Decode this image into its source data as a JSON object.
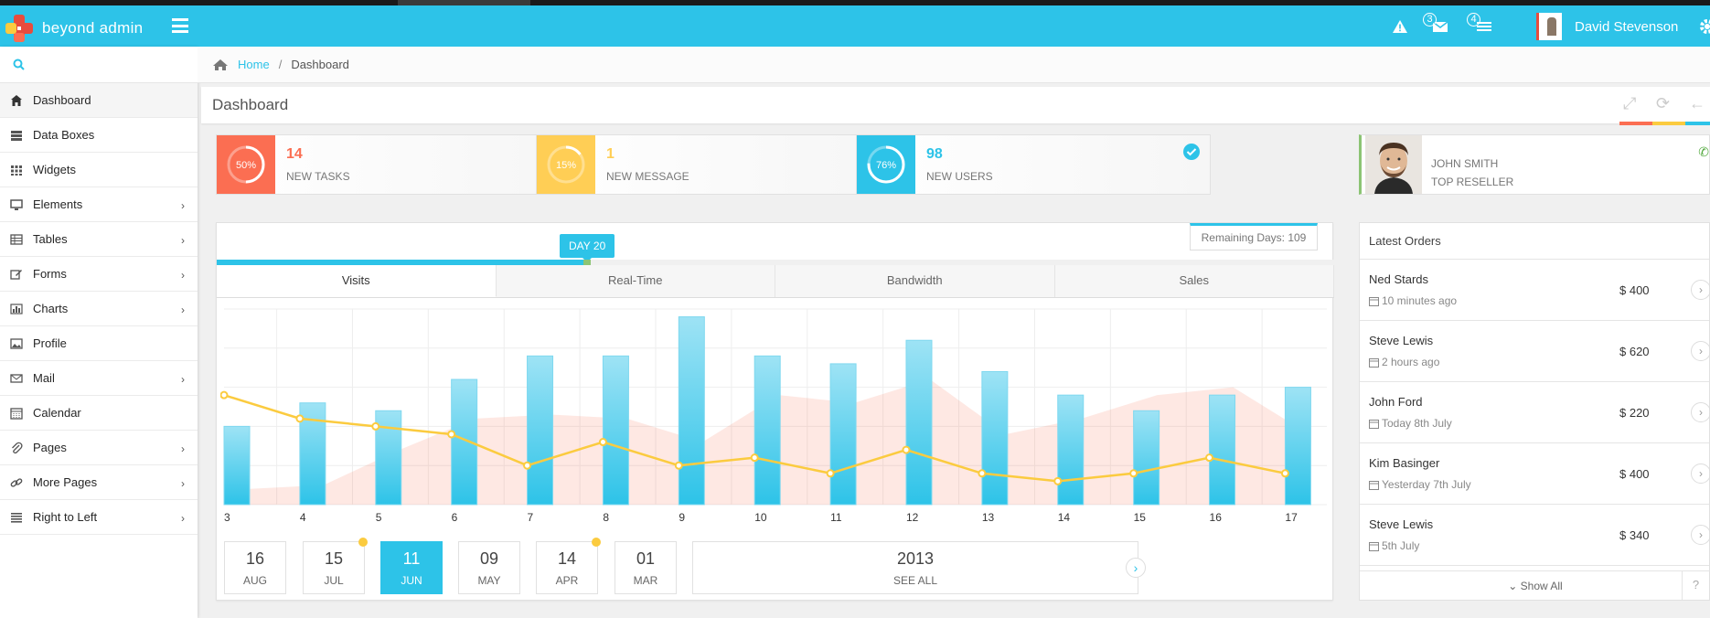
{
  "app": {
    "name": "beyond admin"
  },
  "header": {
    "notifications": {
      "alerts_badge": "",
      "mail_badge": "3",
      "tasks_badge": "4"
    },
    "user_name": "David Stevenson"
  },
  "sidebar": {
    "search_placeholder": "",
    "items": [
      {
        "label": "Dashboard",
        "icon": "home-icon",
        "active": true
      },
      {
        "label": "Data Boxes",
        "icon": "databoxes-icon"
      },
      {
        "label": "Widgets",
        "icon": "widgets-icon"
      },
      {
        "label": "Elements",
        "icon": "desktop-icon",
        "submenu": true
      },
      {
        "label": "Tables",
        "icon": "table-icon",
        "submenu": true
      },
      {
        "label": "Forms",
        "icon": "edit-icon",
        "submenu": true
      },
      {
        "label": "Charts",
        "icon": "chart-icon",
        "submenu": true
      },
      {
        "label": "Profile",
        "icon": "picture-icon"
      },
      {
        "label": "Mail",
        "icon": "envelope-icon",
        "submenu": true
      },
      {
        "label": "Calendar",
        "icon": "calendar-icon"
      },
      {
        "label": "Pages",
        "icon": "paperclip-icon",
        "submenu": true
      },
      {
        "label": "More Pages",
        "icon": "link-icon",
        "submenu": true
      },
      {
        "label": "Right to Left",
        "icon": "align-right-icon",
        "submenu": true
      }
    ]
  },
  "breadcrumb": {
    "home": "Home",
    "sep": "/",
    "current": "Dashboard"
  },
  "page_title": "Dashboard",
  "stats": [
    {
      "percent": "50%",
      "progress": 0.5,
      "value": "14",
      "label": "NEW TASKS",
      "color": "#fb6e52"
    },
    {
      "percent": "15%",
      "progress": 0.15,
      "value": "1",
      "label": "NEW MESSAGE",
      "color": "#ffce55"
    },
    {
      "percent": "76%",
      "progress": 0.76,
      "value": "98",
      "label": "NEW USERS",
      "color": "#2dc3e8"
    }
  ],
  "profile": {
    "name": "JOHN SMITH",
    "role": "TOP RESELLER"
  },
  "chart_panel": {
    "day_tag": "DAY 20",
    "progress_fraction": 0.335,
    "remaining": "Remaining Days: 109",
    "tabs": [
      "Visits",
      "Real-Time",
      "Bandwidth",
      "Sales"
    ],
    "dates": [
      {
        "day": "16",
        "month": "AUG",
        "dot": false
      },
      {
        "day": "15",
        "month": "JUL",
        "dot": true
      },
      {
        "day": "11",
        "month": "JUN",
        "dot": false,
        "active": true
      },
      {
        "day": "09",
        "month": "MAY",
        "dot": false
      },
      {
        "day": "14",
        "month": "APR",
        "dot": true
      },
      {
        "day": "01",
        "month": "MAR",
        "dot": false
      }
    ],
    "year": "2013",
    "see_all": "SEE ALL"
  },
  "chart_data": {
    "type": "bar",
    "categories": [
      "3",
      "4",
      "5",
      "6",
      "7",
      "8",
      "9",
      "10",
      "11",
      "12",
      "13",
      "14",
      "15",
      "16",
      "17"
    ],
    "ylim": [
      0,
      100
    ],
    "series": [
      {
        "type": "bar",
        "values": [
          40,
          52,
          48,
          64,
          76,
          76,
          96,
          76,
          72,
          84,
          68,
          56,
          48,
          56,
          60
        ],
        "color": "#2dc3e8"
      },
      {
        "type": "line",
        "values": [
          56,
          44,
          40,
          36,
          20,
          32,
          20,
          24,
          16,
          28,
          16,
          12,
          16,
          24,
          16
        ],
        "color": "#fbcb3f"
      },
      {
        "type": "area",
        "values": [
          8,
          10,
          28,
          44,
          46,
          44,
          32,
          56,
          52,
          64,
          36,
          44,
          56,
          60,
          36
        ],
        "color": "#fb6e52"
      }
    ]
  },
  "orders": {
    "title": "Latest Orders",
    "items": [
      {
        "name": "Ned Stards",
        "time": "10 minutes ago",
        "amount": "$ 400"
      },
      {
        "name": "Steve Lewis",
        "time": "2 hours ago",
        "amount": "$ 620"
      },
      {
        "name": "John Ford",
        "time": "Today 8th July",
        "amount": "$ 220"
      },
      {
        "name": "Kim Basinger",
        "time": "Yesterday 7th July",
        "amount": "$ 400"
      },
      {
        "name": "Steve Lewis",
        "time": "5th July",
        "amount": "$ 340"
      }
    ],
    "show_all": "Show All",
    "help": "?"
  }
}
